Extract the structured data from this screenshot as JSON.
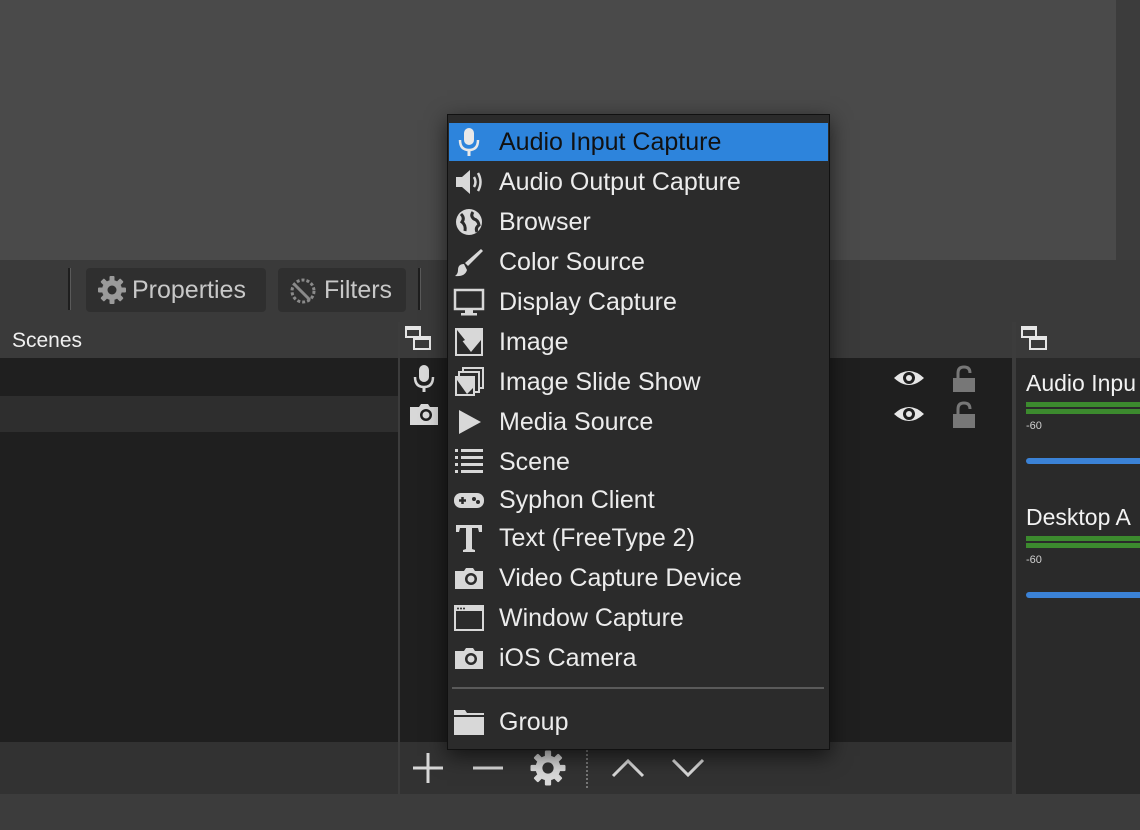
{
  "toolbar": {
    "properties_label": "Properties",
    "filters_label": "Filters"
  },
  "scenes": {
    "title": "Scenes"
  },
  "mixer": {
    "channels": [
      {
        "label": "Audio Inpu",
        "scale_label": "-60"
      },
      {
        "label": "Desktop A",
        "scale_label": "-60"
      }
    ]
  },
  "context_menu": {
    "selected_index": 0,
    "items": [
      {
        "label": "Audio Input Capture",
        "icon": "microphone-icon"
      },
      {
        "label": "Audio Output Capture",
        "icon": "speaker-icon"
      },
      {
        "label": "Browser",
        "icon": "globe-icon"
      },
      {
        "label": "Color Source",
        "icon": "paint-brush-icon"
      },
      {
        "label": "Display Capture",
        "icon": "monitor-icon"
      },
      {
        "label": "Image",
        "icon": "image-icon"
      },
      {
        "label": "Image Slide Show",
        "icon": "slideshow-icon"
      },
      {
        "label": "Media Source",
        "icon": "play-icon"
      },
      {
        "label": "Scene",
        "icon": "list-icon"
      },
      {
        "label": "Syphon Client",
        "icon": "gamepad-icon"
      },
      {
        "label": "Text (FreeType 2)",
        "icon": "text-icon"
      },
      {
        "label": "Video Capture Device",
        "icon": "camera-icon"
      },
      {
        "label": "Window Capture",
        "icon": "window-icon"
      },
      {
        "label": "iOS Camera",
        "icon": "camera-icon"
      },
      {
        "label": "Group",
        "icon": "folder-icon"
      }
    ]
  },
  "colors": {
    "selection": "#2d84dc",
    "meter_green": "#3c8a2e",
    "slider_blue": "#3b82d6"
  }
}
